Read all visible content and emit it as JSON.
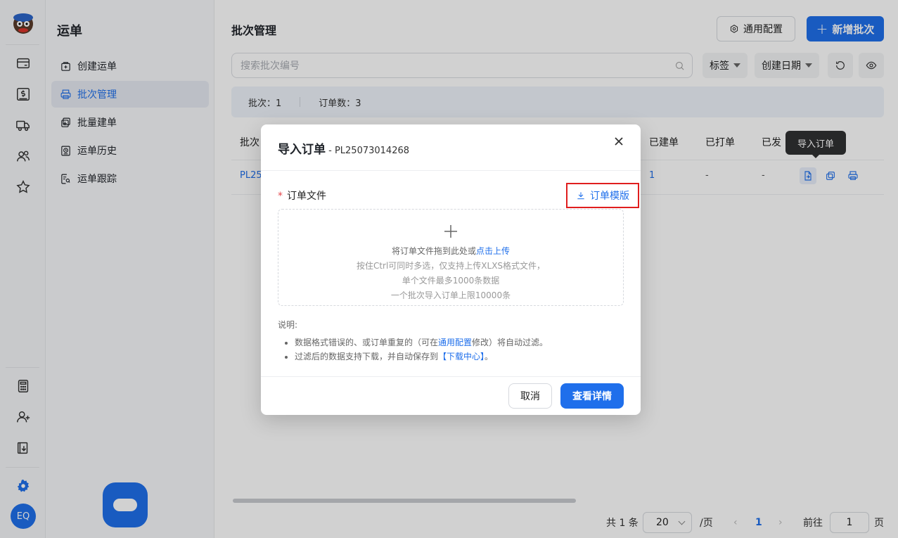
{
  "sidebar": {
    "title": "运单",
    "items": [
      {
        "label": "创建运单",
        "icon": "create-waybill-icon"
      },
      {
        "label": "批次管理",
        "icon": "printer-icon",
        "active": true
      },
      {
        "label": "批量建单",
        "icon": "batch-create-icon"
      },
      {
        "label": "运单历史",
        "icon": "history-icon"
      },
      {
        "label": "运单跟踪",
        "icon": "tracking-icon"
      }
    ]
  },
  "rail": {
    "avatar": "EQ"
  },
  "header": {
    "title": "批次管理",
    "config_button": "通用配置",
    "new_batch_button": "新增批次"
  },
  "toolbar": {
    "search_placeholder": "搜索批次编号",
    "filter_tag": "标签",
    "filter_date": "创建日期"
  },
  "stats": {
    "batches": "批次：1",
    "orders": "订单数：3"
  },
  "table": {
    "columns": [
      "批次",
      "已建单",
      "已打单",
      "已发"
    ],
    "row": {
      "batch_id_partial": "PL25",
      "created": "1",
      "printed": "-",
      "shipped": "-"
    },
    "tooltip": "导入订单"
  },
  "pagination": {
    "total": "共 1 条",
    "page_size": "20",
    "per_page": "/页",
    "current_page": "1",
    "goto_label": "前往",
    "goto_value": "1",
    "page_suffix": "页"
  },
  "modal": {
    "title": "导入订单",
    "batch_id": " - PL25073014268",
    "field_label": "订单文件",
    "template_link": "订单模版",
    "dropzone": {
      "line1_prefix": "将订单文件拖到此处或",
      "line1_link": "点击上传",
      "line2": "按住Ctrl可同时多选，仅支持上传XLXS格式文件，",
      "line3": "单个文件最多1000条数据",
      "line4": "一个批次导入订单上限10000条"
    },
    "notes_title": "说明:",
    "note1_prefix": "数据格式错误的、或订单重复的（可在",
    "note1_link": "通用配置",
    "note1_suffix": "修改）将自动过滤。",
    "note2_prefix": "过滤后的数据支持下载，并自动保存到",
    "note2_link": "【下载中心】",
    "note2_suffix": "。",
    "cancel_button": "取消",
    "view_button": "查看详情"
  },
  "colors": {
    "primary": "#1f6feb",
    "highlight_border": "#e01e1e"
  }
}
